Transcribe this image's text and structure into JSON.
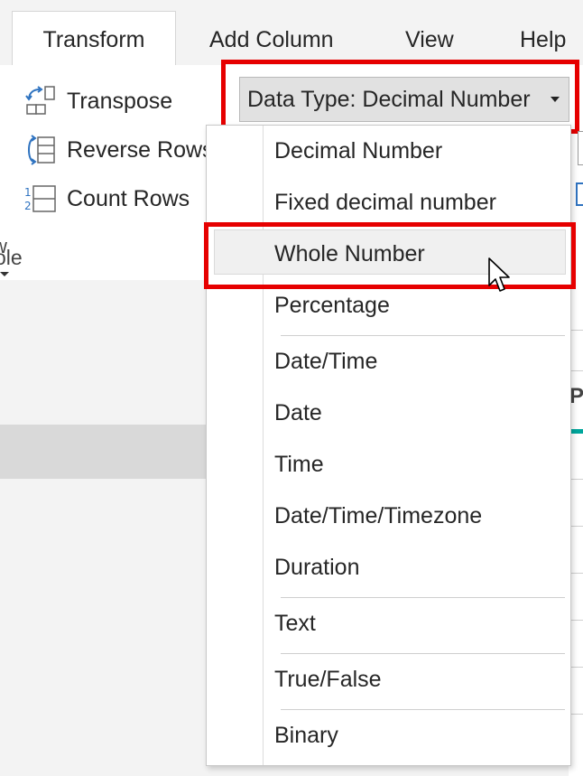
{
  "tabs": [
    {
      "label": "Transform",
      "active": true
    },
    {
      "label": "Add Column",
      "active": false
    },
    {
      "label": "View",
      "active": false
    },
    {
      "label": "Help",
      "active": false
    }
  ],
  "ribbon": {
    "items": [
      {
        "label": "Transpose",
        "icon": "transpose-icon"
      },
      {
        "label": "Reverse Rows",
        "icon": "reverse-rows-icon"
      },
      {
        "label": "Count Rows",
        "icon": "count-rows-icon"
      }
    ],
    "truncated_label": "w",
    "group_label_fragment": "ole"
  },
  "data_type_button": {
    "label": "Data Type: Decimal Number"
  },
  "data_type_menu": {
    "items": [
      {
        "label": "Decimal Number"
      },
      {
        "label": "Fixed decimal number"
      },
      {
        "label": "Whole Number",
        "hovered": true
      },
      {
        "label": "Percentage"
      },
      {
        "label": "Date/Time"
      },
      {
        "label": "Date"
      },
      {
        "label": "Time"
      },
      {
        "label": "Date/Time/Timezone"
      },
      {
        "label": "Duration"
      },
      {
        "label": "Text"
      },
      {
        "label": "True/False"
      },
      {
        "label": "Binary"
      }
    ]
  },
  "table": {
    "header_fragment": "P"
  },
  "colors": {
    "highlight": "#e60000",
    "accent": "#00a69c",
    "button_bg": "#e1e1e1"
  }
}
